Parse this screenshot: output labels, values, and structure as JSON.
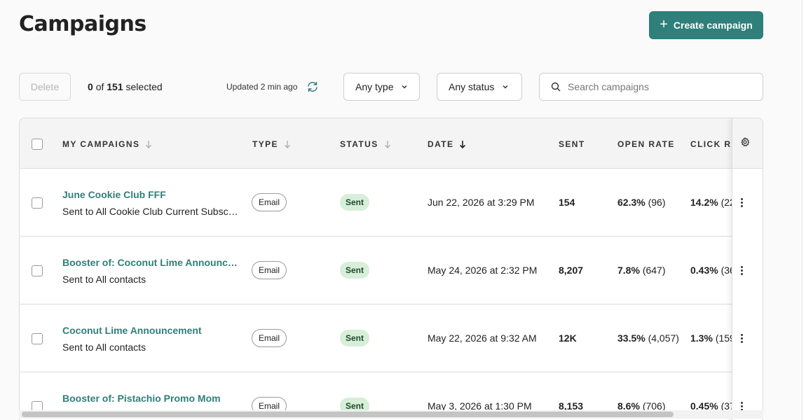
{
  "header": {
    "title": "Campaigns",
    "create_label": "Create campaign"
  },
  "toolbar": {
    "delete_label": "Delete",
    "selected_count": "0",
    "selected_of": "of",
    "selected_total": "151",
    "selected_suffix": "selected",
    "updated_text": "Updated 2 min ago",
    "type_filter": "Any type",
    "status_filter": "Any status",
    "search_placeholder": "Search campaigns"
  },
  "table": {
    "columns": [
      "MY CAMPAIGNS",
      "TYPE",
      "STATUS",
      "DATE",
      "SENT",
      "OPEN RATE",
      "CLICK RA"
    ],
    "rows": [
      {
        "name": "June Cookie Club FFF",
        "subtitle": "Sent to All Cookie Club Current Subscribers",
        "type": "Email",
        "status": "Sent",
        "date": "Jun 22, 2026 at 3:29 PM",
        "sent": "154",
        "open_rate": "62.3%",
        "open_count": "(96)",
        "click_rate": "14.2%",
        "click_count": "(22"
      },
      {
        "name": "Booster of: Coconut Lime Announcement",
        "subtitle": "Sent to All contacts",
        "type": "Email",
        "status": "Sent",
        "date": "May 24, 2026 at 2:32 PM",
        "sent": "8,207",
        "open_rate": "7.8%",
        "open_count": "(647)",
        "click_rate": "0.43%",
        "click_count": "(36"
      },
      {
        "name": "Coconut Lime Announcement",
        "subtitle": "Sent to All contacts",
        "type": "Email",
        "status": "Sent",
        "date": "May 22, 2026 at 9:32 AM",
        "sent": "12K",
        "open_rate": "33.5%",
        "open_count": "(4,057)",
        "click_rate": "1.3%",
        "click_count": "(159"
      },
      {
        "name": "Booster of: Pistachio Promo Mom",
        "subtitle": "",
        "type": "Email",
        "status": "Sent",
        "date": "May 3, 2026 at 1:30 PM",
        "sent": "8,153",
        "open_rate": "8.6%",
        "open_count": "(706)",
        "click_rate": "0.45%",
        "click_count": "(37"
      }
    ]
  },
  "colors": {
    "accent": "#2f7f7a",
    "status_sent_bg": "#d7eed9"
  }
}
